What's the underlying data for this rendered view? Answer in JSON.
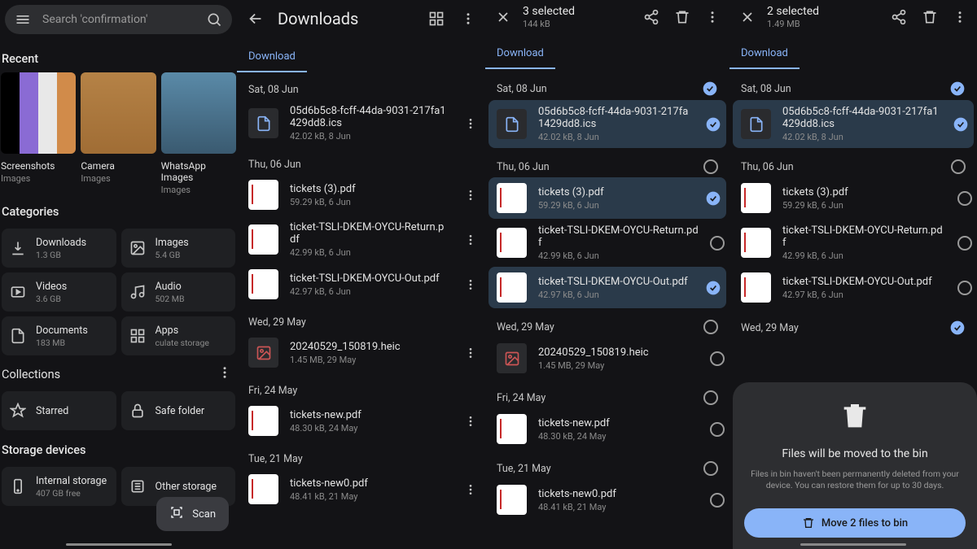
{
  "pane1": {
    "search_placeholder": "Search 'confirmation'",
    "recent_header": "Recent",
    "recents": [
      {
        "label": "Screenshots",
        "sub": "Images"
      },
      {
        "label": "Camera",
        "sub": "Images"
      },
      {
        "label": "WhatsApp Images",
        "sub": "Images"
      }
    ],
    "categories_header": "Categories",
    "categories": [
      {
        "label": "Downloads",
        "sub": "1.3 GB"
      },
      {
        "label": "Images",
        "sub": "5.4 GB"
      },
      {
        "label": "Videos",
        "sub": "3.6 GB"
      },
      {
        "label": "Audio",
        "sub": "502 MB"
      },
      {
        "label": "Documents",
        "sub": "183 MB"
      },
      {
        "label": "Apps",
        "sub": "culate storage"
      }
    ],
    "collections_header": "Collections",
    "collections": [
      {
        "label": "Starred",
        "sub": ""
      },
      {
        "label": "Safe folder",
        "sub": ""
      }
    ],
    "storage_header": "Storage devices",
    "storage": [
      {
        "label": "Internal storage",
        "sub": "407 GB free"
      },
      {
        "label": "Other storage",
        "sub": ""
      }
    ],
    "fab_label": "Scan"
  },
  "pane2": {
    "title": "Downloads",
    "tab": "Download",
    "groups": [
      {
        "date": "Sat, 08 Jun",
        "files": [
          {
            "name": "05d6b5c8-fcff-44da-9031-217fa1429dd8.ics",
            "meta": "42.02 kB, 8 Jun",
            "kind": "ics"
          }
        ]
      },
      {
        "date": "Thu, 06 Jun",
        "files": [
          {
            "name": "tickets (3).pdf",
            "meta": "59.29 kB, 6 Jun",
            "kind": "pdf"
          },
          {
            "name": "ticket-TSLI-DKEM-OYCU-Return.pdf",
            "meta": "42.99 kB, 6 Jun",
            "kind": "pdf"
          },
          {
            "name": "ticket-TSLI-DKEM-OYCU-Out.pdf",
            "meta": "42.97 kB, 6 Jun",
            "kind": "pdf"
          }
        ]
      },
      {
        "date": "Wed, 29 May",
        "files": [
          {
            "name": "20240529_150819.heic",
            "meta": "1.45 MB, 29 May",
            "kind": "heic"
          }
        ]
      },
      {
        "date": "Fri, 24 May",
        "files": [
          {
            "name": "tickets-new.pdf",
            "meta": "48.30 kB, 24 May",
            "kind": "pdf"
          }
        ]
      },
      {
        "date": "Tue, 21 May",
        "files": [
          {
            "name": "tickets-new0.pdf",
            "meta": "48.41 kB, 21 May",
            "kind": "pdf"
          }
        ]
      }
    ]
  },
  "pane3": {
    "selected_count": "3 selected",
    "selected_size": "144 kB",
    "tab": "Download",
    "groups": [
      {
        "date": "Sat, 08 Jun",
        "checked": true,
        "files": [
          {
            "name": "05d6b5c8-fcff-44da-9031-217fa1429dd8.ics",
            "meta": "42.02 kB, 8 Jun",
            "kind": "ics",
            "selected": true
          }
        ]
      },
      {
        "date": "Thu, 06 Jun",
        "checked": false,
        "files": [
          {
            "name": "tickets (3).pdf",
            "meta": "59.29 kB, 6 Jun",
            "kind": "pdf",
            "selected": true
          },
          {
            "name": "ticket-TSLI-DKEM-OYCU-Return.pdf",
            "meta": "42.99 kB, 6 Jun",
            "kind": "pdf",
            "selected": false
          },
          {
            "name": "ticket-TSLI-DKEM-OYCU-Out.pdf",
            "meta": "42.97 kB, 6 Jun",
            "kind": "pdf",
            "selected": true
          }
        ]
      },
      {
        "date": "Wed, 29 May",
        "checked": false,
        "files": [
          {
            "name": "20240529_150819.heic",
            "meta": "1.45 MB, 29 May",
            "kind": "heic",
            "selected": false
          }
        ]
      },
      {
        "date": "Fri, 24 May",
        "checked": false,
        "files": [
          {
            "name": "tickets-new.pdf",
            "meta": "48.30 kB, 24 May",
            "kind": "pdf",
            "selected": false
          }
        ]
      },
      {
        "date": "Tue, 21 May",
        "checked": false,
        "files": [
          {
            "name": "tickets-new0.pdf",
            "meta": "48.41 kB, 21 May",
            "kind": "pdf",
            "selected": false
          }
        ]
      }
    ]
  },
  "pane4": {
    "selected_count": "2 selected",
    "selected_size": "1.49 MB",
    "tab": "Download",
    "groups": [
      {
        "date": "Sat, 08 Jun",
        "checked": true,
        "files": [
          {
            "name": "05d6b5c8-fcff-44da-9031-217fa1429dd8.ics",
            "meta": "42.02 kB, 8 Jun",
            "kind": "ics",
            "selected": true
          }
        ]
      },
      {
        "date": "Thu, 06 Jun",
        "checked": false,
        "files": [
          {
            "name": "tickets (3).pdf",
            "meta": "59.29 kB, 6 Jun",
            "kind": "pdf",
            "selected": false
          },
          {
            "name": "ticket-TSLI-DKEM-OYCU-Return.pdf",
            "meta": "42.99 kB, 6 Jun",
            "kind": "pdf",
            "selected": false
          },
          {
            "name": "ticket-TSLI-DKEM-OYCU-Out.pdf",
            "meta": "42.97 kB, 6 Jun",
            "kind": "pdf",
            "selected": false
          }
        ]
      },
      {
        "date": "Wed, 29 May",
        "checked": true,
        "files": []
      }
    ],
    "sheet": {
      "title": "Files will be moved to the bin",
      "desc": "Files in bin haven't been permanently deleted from your device. You can restore them for up to 30 days.",
      "button": "Move 2 files to bin"
    }
  }
}
